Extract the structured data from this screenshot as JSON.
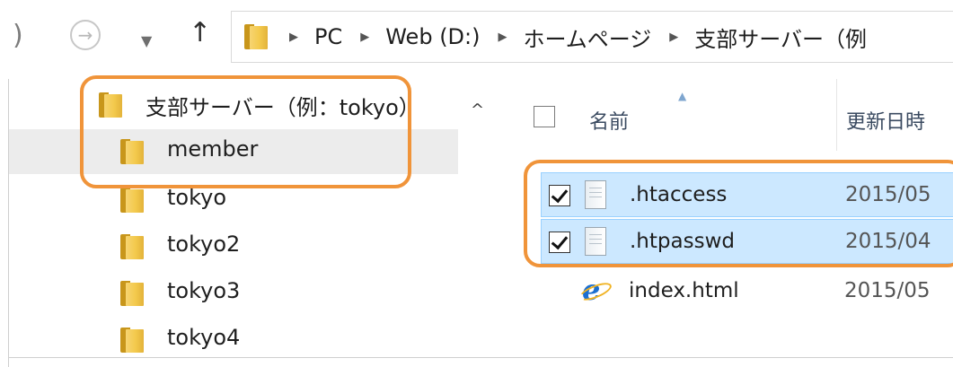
{
  "nav": {
    "back_glyph": "⟵",
    "forward_glyph": "→",
    "dropdown_glyph": "▼",
    "up_glyph": "↑"
  },
  "address": {
    "separator": "▶",
    "crumbs": [
      "PC",
      "Web (D:)",
      "ホームページ",
      "支部サーバー（例"
    ]
  },
  "tree": {
    "items": [
      {
        "label": "支部サーバー（例：tokyo）"
      },
      {
        "label": "member"
      },
      {
        "label": "tokyo"
      },
      {
        "label": "tokyo2"
      },
      {
        "label": "tokyo3"
      },
      {
        "label": "tokyo4"
      }
    ],
    "scroll_up_glyph": "^"
  },
  "columns": {
    "name": "名前",
    "sort_glyph": "▲",
    "date": "更新日時"
  },
  "files": [
    {
      "name": ".htaccess",
      "date": "2015/05",
      "checked": true,
      "icon": "text-file-icon"
    },
    {
      "name": ".htpasswd",
      "date": "2015/04",
      "checked": true,
      "icon": "text-file-icon"
    },
    {
      "name": "index.html",
      "date": "2015/05",
      "checked": false,
      "icon": "ie-html-icon"
    }
  ],
  "colors": {
    "highlight_outline": "#f0943a",
    "selection_fill": "#cce8ff",
    "selection_border": "#99d1ff",
    "folder_yellow": "#f3c94c"
  }
}
